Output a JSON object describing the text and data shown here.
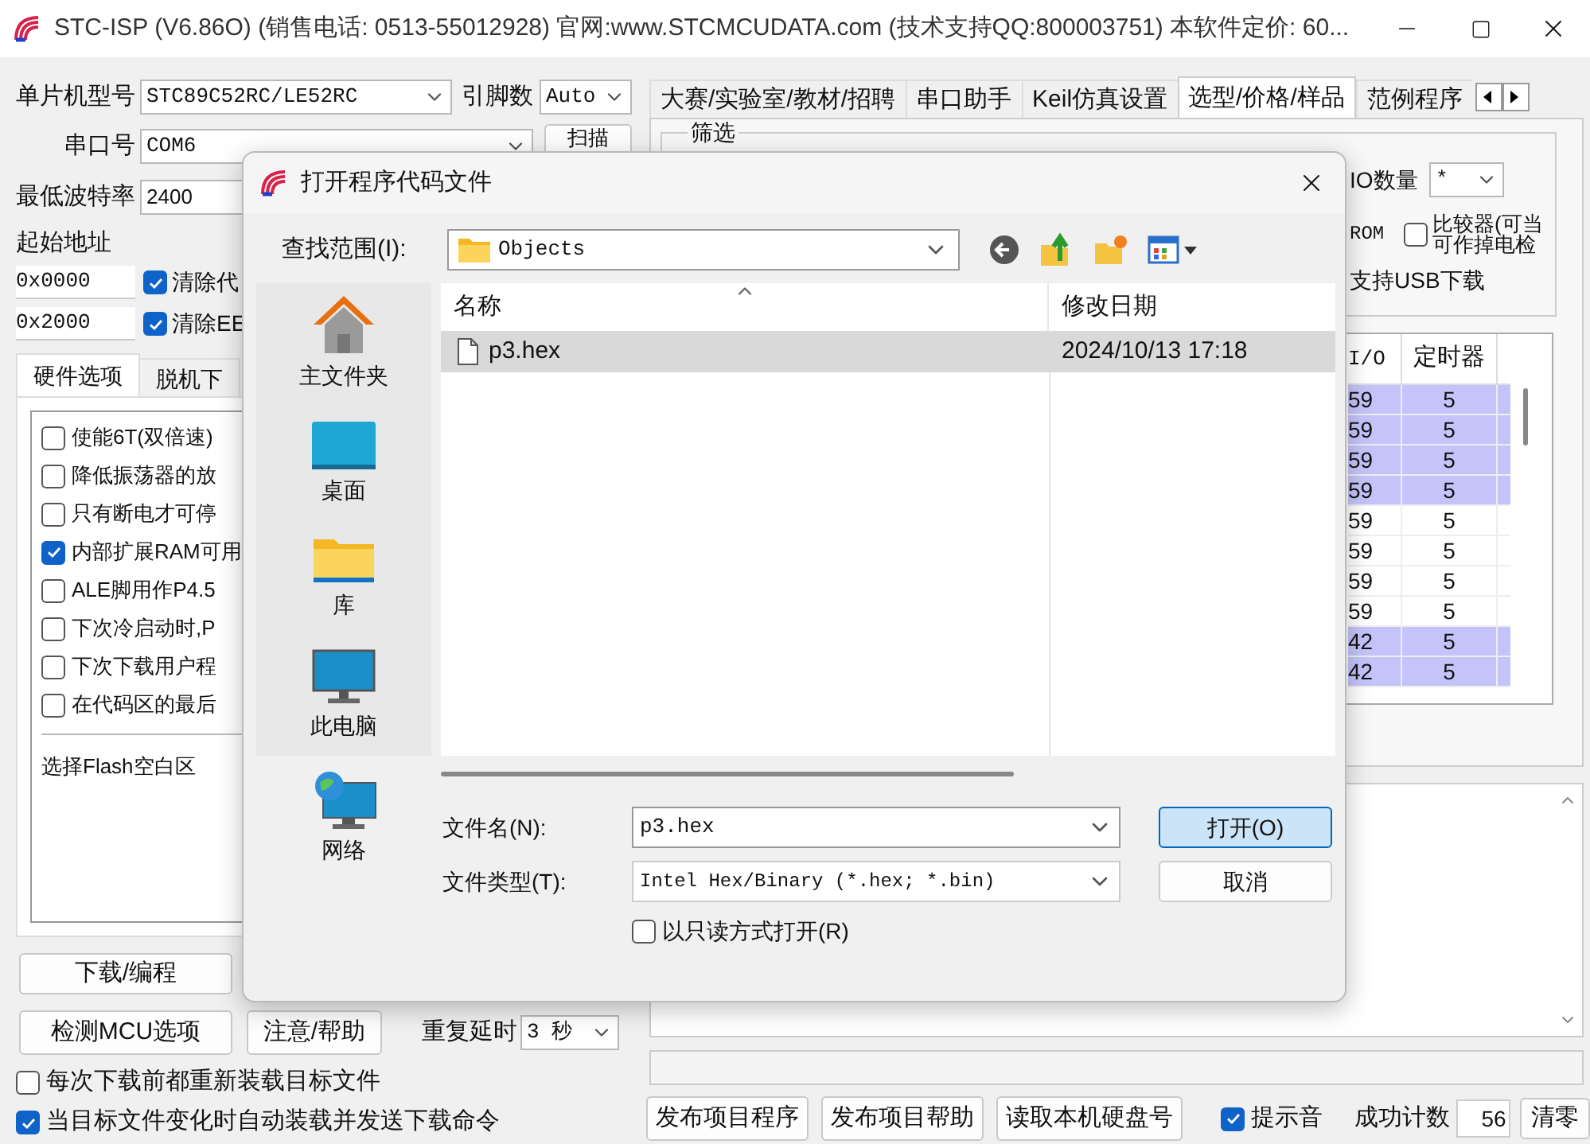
{
  "window": {
    "title": "STC-ISP (V6.86O) (销售电话: 0513-55012928) 官网:www.STCMCUDATA.com  (技术支持QQ:800003751) 本软件定价: 60..."
  },
  "left": {
    "mcu": {
      "label": "单片机型号",
      "value": "STC89C52RC/LE52RC"
    },
    "pins": {
      "label": "引脚数",
      "value": "Auto"
    },
    "port": {
      "label": "串口号",
      "value": "COM6"
    },
    "scan_button": "扫描",
    "baud": {
      "label": "最低波特率",
      "value": "2400"
    },
    "start_address": "起始地址",
    "addresses": [
      {
        "value": "0x0000",
        "label": "清除代",
        "checked": true
      },
      {
        "value": "0x2000",
        "label": "清除EE",
        "checked": true
      }
    ],
    "tabs": [
      {
        "label": "硬件选项",
        "selected": true
      },
      {
        "label": "脱机下",
        "selected": false
      }
    ],
    "options": [
      {
        "label": "使能6T(双倍速)",
        "checked": false
      },
      {
        "label": "降低振荡器的放",
        "checked": false
      },
      {
        "label": "只有断电才可停",
        "checked": false
      },
      {
        "label": "内部扩展RAM可用",
        "checked": true
      },
      {
        "label": "ALE脚用作P4.5",
        "checked": false
      },
      {
        "label": "下次冷启动时,P",
        "checked": false
      },
      {
        "label": "下次下载用户程",
        "checked": false
      },
      {
        "label": "在代码区的最后",
        "checked": false
      }
    ],
    "flash_note": "选择Flash空白区",
    "download_button": "下载/编程",
    "detect_button": "检测MCU选项",
    "help_button": "注意/帮助",
    "repeat_delay": {
      "label": "重复延时",
      "value": "3 秒"
    },
    "checks": [
      {
        "label": "每次下载前都重新装载目标文件",
        "checked": false
      },
      {
        "label": "当目标文件变化时自动装载并发送下载命令",
        "checked": true
      }
    ]
  },
  "right": {
    "tabs": [
      {
        "label": "大赛/实验室/教材/招聘",
        "selected": false
      },
      {
        "label": "串口助手",
        "selected": false
      },
      {
        "label": "Keil仿真设置",
        "selected": false
      },
      {
        "label": "选型/价格/样品",
        "selected": true
      },
      {
        "label": "范例程序",
        "selected": false
      }
    ],
    "filter": {
      "title": "筛选",
      "io_label": "IO数量",
      "io_value": "*",
      "rom_label": "ROM",
      "comparator": {
        "lines": [
          "比较器(可当",
          "可作掉电检"
        ],
        "checked": false
      },
      "usb_label": "支持USB下载"
    },
    "table": {
      "columns": [
        "I/O",
        "定时器"
      ],
      "rows": [
        {
          "cells": [
            "59",
            "5"
          ],
          "selected": true
        },
        {
          "cells": [
            "59",
            "5"
          ],
          "selected": true
        },
        {
          "cells": [
            "59",
            "5"
          ],
          "selected": true
        },
        {
          "cells": [
            "59",
            "5"
          ],
          "selected": true
        },
        {
          "cells": [
            "59",
            "5"
          ],
          "selected": false
        },
        {
          "cells": [
            "59",
            "5"
          ],
          "selected": false
        },
        {
          "cells": [
            "59",
            "5"
          ],
          "selected": false
        },
        {
          "cells": [
            "59",
            "5"
          ],
          "selected": false
        },
        {
          "cells": [
            "42",
            "5"
          ],
          "selected": true
        },
        {
          "cells": [
            "42",
            "5"
          ],
          "selected": true
        }
      ]
    },
    "progress": {
      "level": 0
    },
    "publish_buttons": [
      "发布项目程序",
      "发布项目帮助",
      "读取本机硬盘号"
    ],
    "beep": {
      "label": "提示音",
      "checked": true
    },
    "count": {
      "label": "成功计数",
      "value": "56"
    },
    "clear_button": "清零"
  },
  "dialog": {
    "title": "打开程序代码文件",
    "look_in": {
      "label": "查找范围(I):",
      "value": "Objects"
    },
    "places": [
      {
        "kind": "home",
        "label": "主文件夹"
      },
      {
        "kind": "desktop",
        "label": "桌面"
      },
      {
        "kind": "library",
        "label": "库"
      },
      {
        "kind": "pc",
        "label": "此电脑"
      },
      {
        "kind": "network",
        "label": "网络"
      }
    ],
    "columns": [
      "名称",
      "修改日期"
    ],
    "files": [
      {
        "name": "p3.hex",
        "modified": "2024/10/13 17:18",
        "selected": true
      }
    ],
    "file_name": {
      "label": "文件名(N):",
      "value": "p3.hex"
    },
    "file_type": {
      "label": "文件类型(T):",
      "value": "Intel Hex/Binary (*.hex; *.bin)"
    },
    "read_only": {
      "label": "以只读方式打开(R)",
      "checked": false
    },
    "open_button": "打开(O)",
    "cancel_button": "取消"
  }
}
